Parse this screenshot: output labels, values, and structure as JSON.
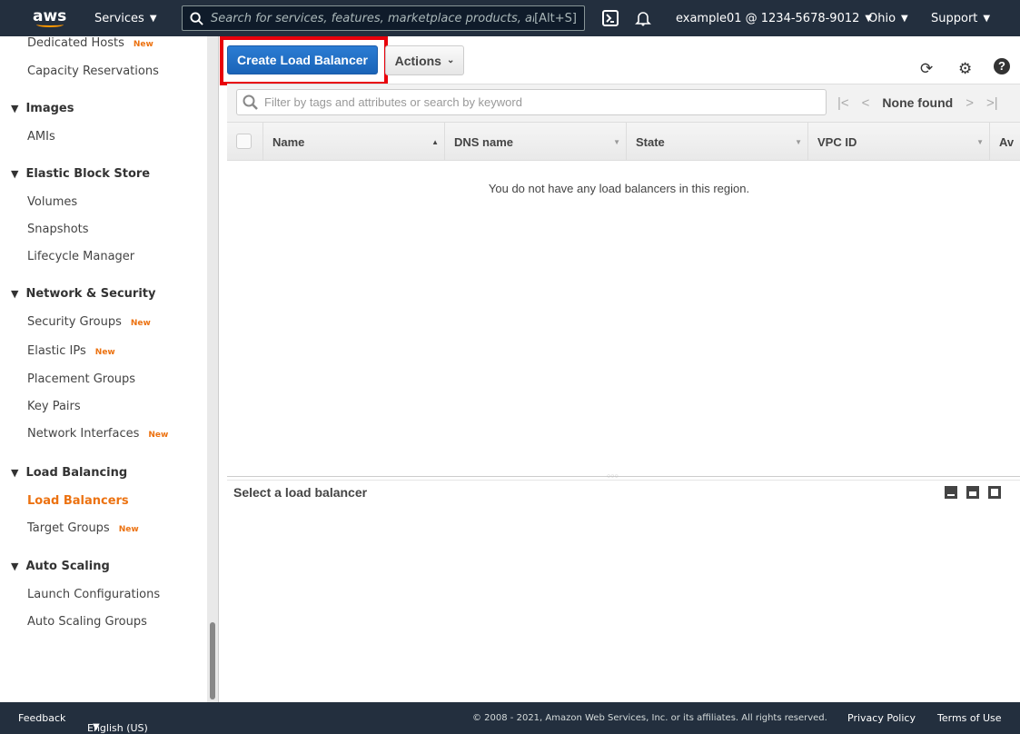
{
  "topnav": {
    "logo": "aws",
    "services": "Services",
    "search_placeholder": "Search for services, features, marketplace products, and docs",
    "search_shortcut": "[Alt+S]",
    "account": "example01 @ 1234-5678-9012",
    "region": "Ohio",
    "support": "Support"
  },
  "sidebar": {
    "items": [
      {
        "type": "item",
        "label": "Dedicated Hosts",
        "badge": "New"
      },
      {
        "type": "item",
        "label": "Capacity Reservations"
      },
      {
        "type": "header",
        "label": "Images"
      },
      {
        "type": "item",
        "label": "AMIs"
      },
      {
        "type": "header",
        "label": "Elastic Block Store"
      },
      {
        "type": "item",
        "label": "Volumes"
      },
      {
        "type": "item",
        "label": "Snapshots"
      },
      {
        "type": "item",
        "label": "Lifecycle Manager"
      },
      {
        "type": "header",
        "label": "Network & Security"
      },
      {
        "type": "item",
        "label": "Security Groups",
        "badge": "New"
      },
      {
        "type": "item",
        "label": "Elastic IPs",
        "badge": "New"
      },
      {
        "type": "item",
        "label": "Placement Groups"
      },
      {
        "type": "item",
        "label": "Key Pairs"
      },
      {
        "type": "item",
        "label": "Network Interfaces",
        "badge": "New"
      },
      {
        "type": "header",
        "label": "Load Balancing"
      },
      {
        "type": "item",
        "label": "Load Balancers",
        "active": true
      },
      {
        "type": "item",
        "label": "Target Groups",
        "badge": "New"
      },
      {
        "type": "header",
        "label": "Auto Scaling"
      },
      {
        "type": "item",
        "label": "Launch Configurations"
      },
      {
        "type": "item",
        "label": "Auto Scaling Groups"
      }
    ]
  },
  "toolbar": {
    "create_label": "Create Load Balancer",
    "actions_label": "Actions"
  },
  "filter": {
    "placeholder": "Filter by tags and attributes or search by keyword"
  },
  "pager": {
    "status": "None found"
  },
  "table": {
    "columns": [
      "Name",
      "DNS name",
      "State",
      "VPC ID",
      "Av"
    ],
    "empty_message": "You do not have any load balancers in this region."
  },
  "detail": {
    "title": "Select a load balancer"
  },
  "footer": {
    "feedback": "Feedback",
    "language": "English (US)",
    "copyright": "© 2008 - 2021, Amazon Web Services, Inc. or its affiliates. All rights reserved.",
    "privacy": "Privacy Policy",
    "terms": "Terms of Use"
  },
  "colors": {
    "nav_bg": "#232f3e",
    "accent_orange": "#ec7211",
    "primary_blue": "#1a64b8",
    "highlight_red": "#e8000b"
  }
}
